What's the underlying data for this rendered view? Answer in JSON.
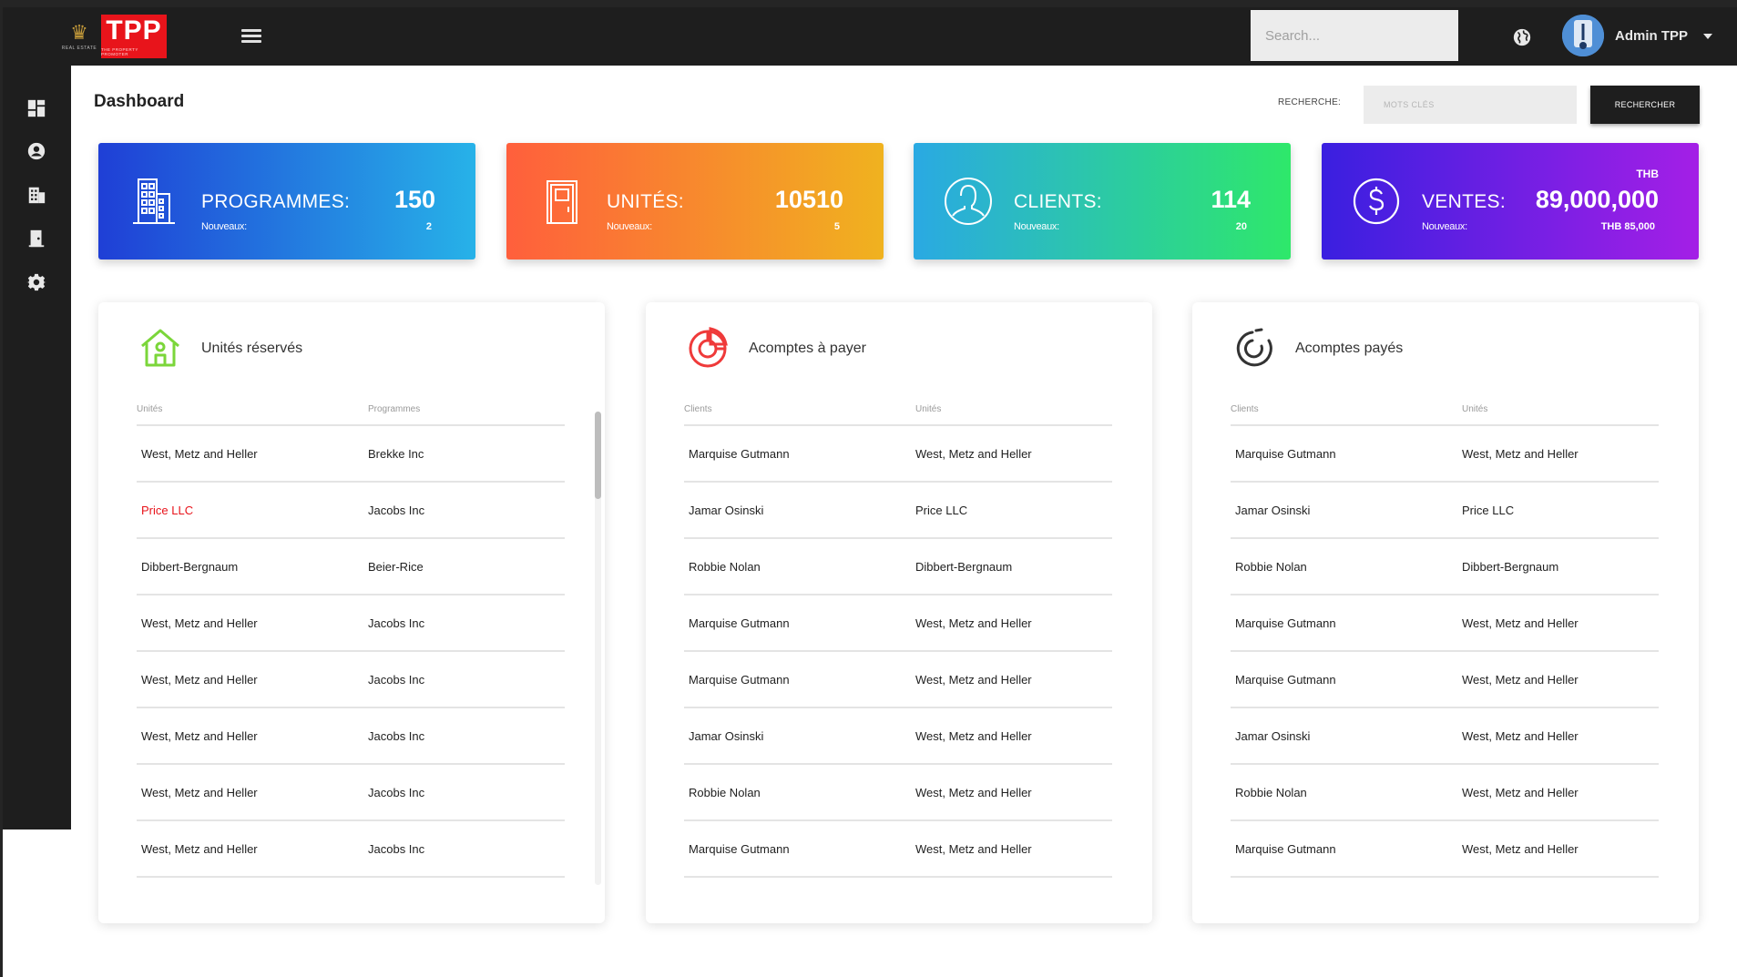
{
  "brand": {
    "crest_text": "REAL ESTATE",
    "logo": "TPP",
    "tagline": "THE PROPERTY PROMOTER"
  },
  "topbar": {
    "search_placeholder": "Search...",
    "user_name": "Admin TPP",
    "icons": [
      "menu-icon",
      "globe-icon",
      "avatar",
      "chevron-down-icon"
    ]
  },
  "sidebar": {
    "items": [
      {
        "icon": "dashboard-icon"
      },
      {
        "icon": "user-circle-icon"
      },
      {
        "icon": "building-icon"
      },
      {
        "icon": "door-icon"
      },
      {
        "icon": "gear-icon"
      }
    ]
  },
  "header": {
    "title": "Dashboard",
    "search_label": "RECHERCHE:",
    "search_placeholder": "MOTS CLÉS",
    "search_button": "RECHERCHER"
  },
  "stats": [
    {
      "title": "PROGRAMMES:",
      "value": "150",
      "sub": "Nouveaux:",
      "new": "2",
      "icon": "building-icon",
      "gradient": [
        "#1f3fd6",
        "#27b2e8"
      ]
    },
    {
      "title": "UNITÉS:",
      "value": "10510",
      "sub": "Nouveaux:",
      "new": "5",
      "icon": "door-icon",
      "gradient": [
        "#ff5f3c",
        "#f0b21f"
      ]
    },
    {
      "title": "CLIENTS:",
      "value": "114",
      "sub": "Nouveaux:",
      "new": "20",
      "icon": "user-circle-icon",
      "gradient": [
        "#2aa9e3",
        "#2ee86a"
      ]
    },
    {
      "title": "VENTES:",
      "value": "89,000,000",
      "currency": "THB",
      "sub": "Nouveaux:",
      "new": "THB 85,000",
      "icon": "dollar-circle-icon",
      "gradient": [
        "#3a1fe0",
        "#a41fe6"
      ]
    }
  ],
  "panels": [
    {
      "title": "Unités réservés",
      "icon": "house-icon",
      "columns": [
        "Unités",
        "Programmes"
      ],
      "rows": [
        [
          "West, Metz and Heller",
          "Brekke Inc"
        ],
        [
          "Price LLC",
          "Jacobs Inc"
        ],
        [
          "Dibbert-Bergnaum",
          "Beier-Rice"
        ],
        [
          "West, Metz and Heller",
          "Jacobs Inc"
        ],
        [
          "West, Metz and Heller",
          "Jacobs Inc"
        ],
        [
          "West, Metz and Heller",
          "Jacobs Inc"
        ],
        [
          "West, Metz and Heller",
          "Jacobs Inc"
        ],
        [
          "West, Metz and Heller",
          "Jacobs Inc"
        ]
      ],
      "highlight_row": 1,
      "highlight_color": "#e8141b"
    },
    {
      "title": "Acomptes à payer",
      "icon": "donut-chart-icon",
      "columns": [
        "Clients",
        "Unités"
      ],
      "rows": [
        [
          "Marquise Gutmann",
          "West, Metz and Heller"
        ],
        [
          "Jamar Osinski",
          "Price LLC"
        ],
        [
          "Robbie Nolan",
          "Dibbert-Bergnaum"
        ],
        [
          "Marquise Gutmann",
          "West, Metz and Heller"
        ],
        [
          "Marquise Gutmann",
          "West, Metz and Heller"
        ],
        [
          "Jamar Osinski",
          "West, Metz and Heller"
        ],
        [
          "Robbie Nolan",
          "West, Metz and Heller"
        ],
        [
          "Marquise Gutmann",
          "West, Metz and Heller"
        ]
      ]
    },
    {
      "title": "Acomptes payés",
      "icon": "progress-circle-icon",
      "columns": [
        "Clients",
        "Unités"
      ],
      "rows": [
        [
          "Marquise Gutmann",
          "West, Metz and Heller"
        ],
        [
          "Jamar Osinski",
          "Price LLC"
        ],
        [
          "Robbie Nolan",
          "Dibbert-Bergnaum"
        ],
        [
          "Marquise Gutmann",
          "West, Metz and Heller"
        ],
        [
          "Marquise Gutmann",
          "West, Metz and Heller"
        ],
        [
          "Jamar Osinski",
          "West, Metz and Heller"
        ],
        [
          "Robbie Nolan",
          "West, Metz and Heller"
        ],
        [
          "Marquise Gutmann",
          "West, Metz and Heller"
        ]
      ]
    }
  ],
  "colors": {
    "accent_red": "#e8141b",
    "dark": "#1e1e1e",
    "house_green": "#7bd63a",
    "donut_red": "#ef3a3a"
  }
}
